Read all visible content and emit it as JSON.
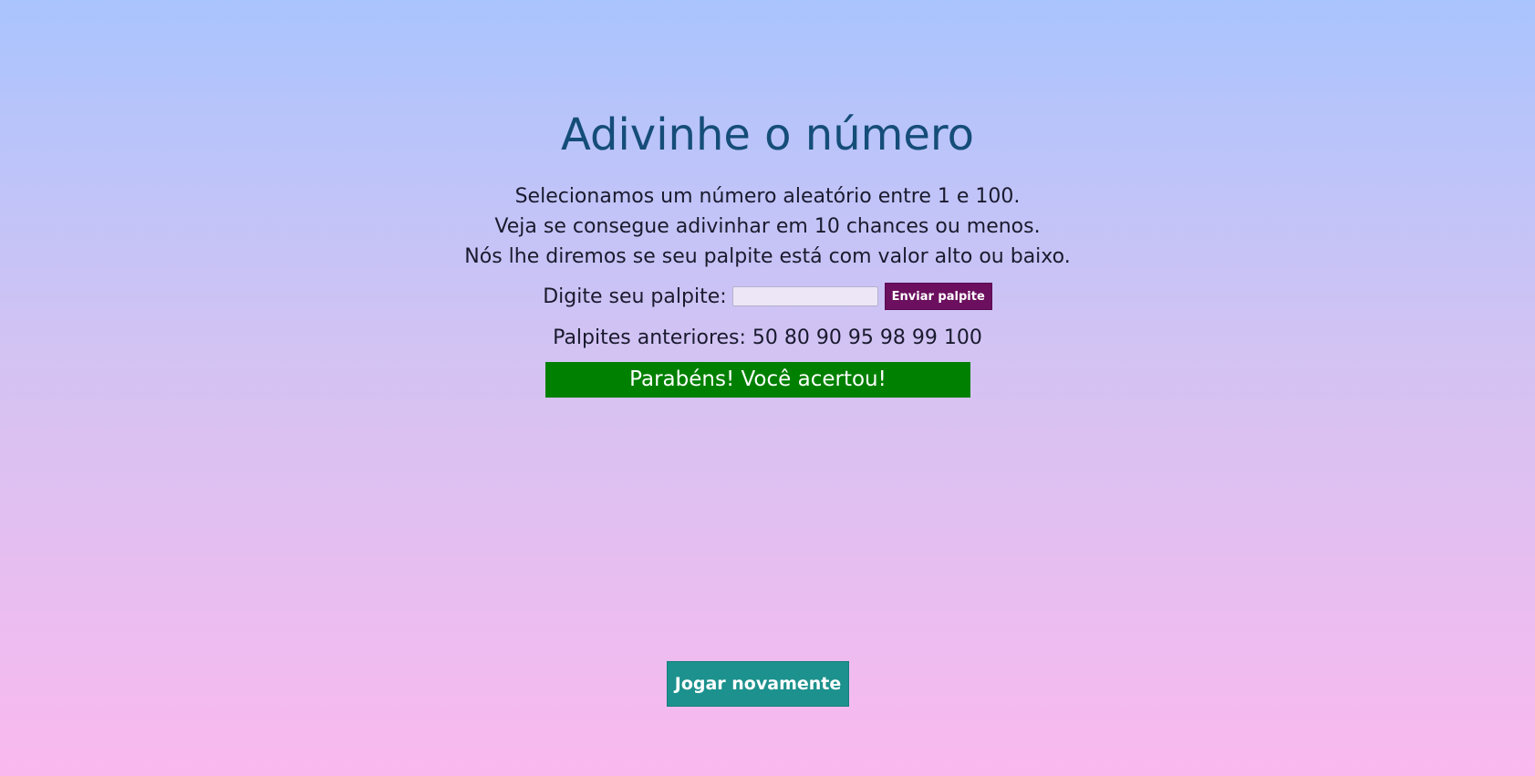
{
  "page": {
    "title": "Adivinhe o número",
    "intro_lines": [
      "Selecionamos um número aleatório entre 1 e 100.",
      "Veja se consegue adivinhar em 10 chances ou menos.",
      "Nós lhe diremos se seu palpite está com valor alto ou baixo."
    ]
  },
  "form": {
    "label": "Digite seu palpite:",
    "input_value": "",
    "submit_label": "Enviar palpite"
  },
  "previous_guesses": "Palpites anteriores: 50 80 90 95 98 99 100",
  "result": {
    "message": "Parabéns! Você acertou!",
    "color": "#008000"
  },
  "replay": {
    "label": "Jogar novamente"
  },
  "colors": {
    "title": "#154d79",
    "submit_button": "#6b0f5e",
    "replay_button": "#1c918d",
    "background_top": "#aac4fe",
    "background_bottom": "#fab9ee"
  }
}
